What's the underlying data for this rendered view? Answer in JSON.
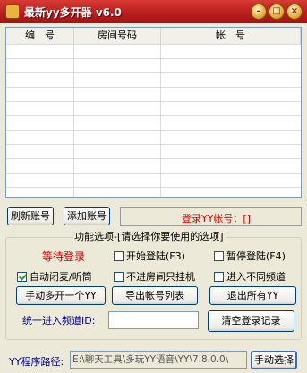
{
  "window": {
    "title": "最新yy多开器 v6.0"
  },
  "list": {
    "columns": [
      "编　号",
      "房间号码",
      "帐　号"
    ],
    "rows": []
  },
  "buttons": {
    "refresh": "刷新账号",
    "add": "添加账号",
    "manual_open": "手动多开一个YY",
    "export": "导出帐号列表",
    "exit_all": "退出所有YY",
    "clear_log": "清空登录记录",
    "manual_select": "手动选择"
  },
  "status": {
    "login_label": "登录YY帐号：[]"
  },
  "options": {
    "group_title": "功能选项-[请选择你要使用的选项]",
    "state_text": "等待登录",
    "start_login": {
      "label": "开始登陆(F3)",
      "checked": false
    },
    "pause_login": {
      "label": "暂停登陆(F4)",
      "checked": false
    },
    "auto_close": {
      "label": "自动闭麦/听筒",
      "checked": true
    },
    "no_room": {
      "label": "不进房间只挂机",
      "checked": false
    },
    "diff_channel": {
      "label": "进入不同频道",
      "checked": false
    },
    "channel_label": "统一进入频道ID:",
    "channel_value": ""
  },
  "path": {
    "label": "YY程序路径:",
    "value": "E:\\聊天工具\\多玩YY语音\\YY\\7.8.0.0\\"
  },
  "colors": {
    "accent": "#d00000",
    "title_bg": "#b81c1c"
  }
}
